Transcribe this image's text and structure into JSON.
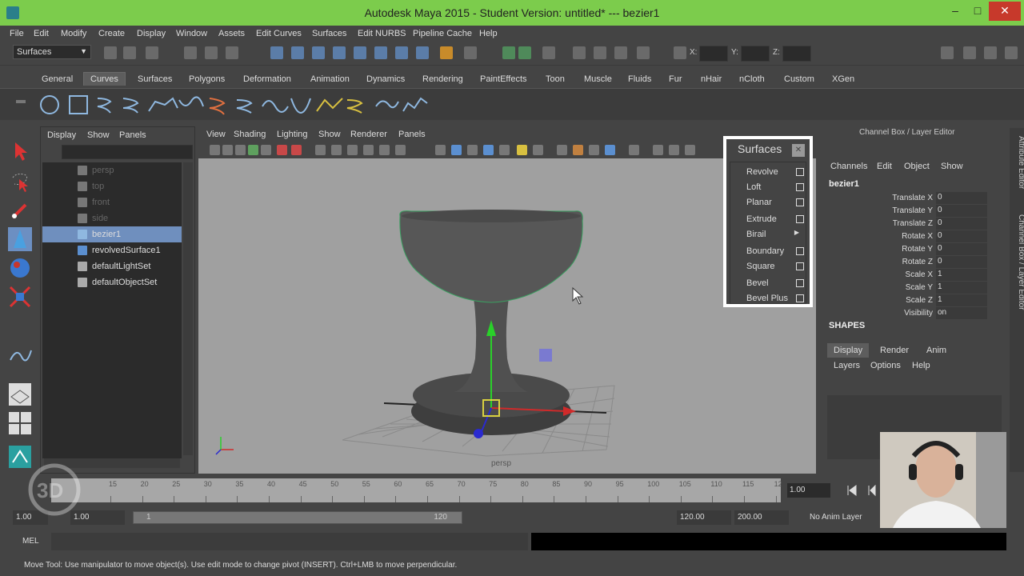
{
  "window": {
    "title": "Autodesk Maya 2015 - Student Version: untitled*   ---   bezier1"
  },
  "menubar": [
    "File",
    "Edit",
    "Modify",
    "Create",
    "Display",
    "Window",
    "Assets",
    "Edit Curves",
    "Surfaces",
    "Edit NURBS",
    "Pipeline Cache",
    "Help"
  ],
  "statusline": {
    "mode": "Surfaces",
    "x_label": "X:",
    "y_label": "Y:",
    "z_label": "Z:"
  },
  "shelf_tabs": [
    "General",
    "Curves",
    "Surfaces",
    "Polygons",
    "Deformation",
    "Animation",
    "Dynamics",
    "Rendering",
    "PaintEffects",
    "Toon",
    "Muscle",
    "Fluids",
    "Fur",
    "nHair",
    "nCloth",
    "Custom",
    "XGen"
  ],
  "shelf_active": "Curves",
  "outliner": {
    "menu": [
      "Display",
      "Show",
      "Panels"
    ],
    "items": [
      {
        "label": "persp",
        "dim": true
      },
      {
        "label": "top",
        "dim": true
      },
      {
        "label": "front",
        "dim": true
      },
      {
        "label": "side",
        "dim": true
      },
      {
        "label": "bezier1",
        "selected": true
      },
      {
        "label": "revolvedSurface1"
      },
      {
        "label": "defaultLightSet"
      },
      {
        "label": "defaultObjectSet"
      }
    ]
  },
  "viewport": {
    "menu": [
      "View",
      "Shading",
      "Lighting",
      "Show",
      "Renderer",
      "Panels"
    ],
    "camera": "persp"
  },
  "surfaces_popup": {
    "title": "Surfaces",
    "items": [
      {
        "label": "Revolve",
        "kind": "box"
      },
      {
        "label": "Loft",
        "kind": "box"
      },
      {
        "label": "Planar",
        "kind": "box"
      },
      {
        "label": "Extrude",
        "kind": "box"
      },
      {
        "label": "Birail",
        "kind": "arrow"
      },
      {
        "label": "Boundary",
        "kind": "box"
      },
      {
        "label": "Square",
        "kind": "box"
      },
      {
        "label": "Bevel",
        "kind": "box"
      },
      {
        "label": "Bevel Plus",
        "kind": "box"
      }
    ]
  },
  "channel_box": {
    "title": "Channel Box / Layer Editor",
    "menu": [
      "Channels",
      "Edit",
      "Object",
      "Show"
    ],
    "object": "bezier1",
    "attributes": [
      {
        "name": "Translate X",
        "value": "0"
      },
      {
        "name": "Translate Y",
        "value": "0"
      },
      {
        "name": "Translate Z",
        "value": "0"
      },
      {
        "name": "Rotate X",
        "value": "0"
      },
      {
        "name": "Rotate Y",
        "value": "0"
      },
      {
        "name": "Rotate Z",
        "value": "0"
      },
      {
        "name": "Scale X",
        "value": "1"
      },
      {
        "name": "Scale Y",
        "value": "1"
      },
      {
        "name": "Scale Z",
        "value": "1"
      },
      {
        "name": "Visibility",
        "value": "on"
      }
    ],
    "shapes_label": "SHAPES",
    "layer_tabs": [
      "Display",
      "Render",
      "Anim"
    ],
    "layer_menu": [
      "Layers",
      "Options",
      "Help"
    ]
  },
  "side_tabs": [
    "Attribute Editor",
    "Channel Box / Layer Editor"
  ],
  "timeline": {
    "ticks": [
      "15",
      "20",
      "25",
      "30",
      "35",
      "40",
      "45",
      "50",
      "55",
      "60",
      "65",
      "70",
      "75",
      "80",
      "85",
      "90",
      "95",
      "100",
      "105",
      "110",
      "115",
      "12"
    ],
    "current_time": "1.00"
  },
  "range": {
    "start": "1.00",
    "inner_start": "1.00",
    "bar_start": "1",
    "bar_end": "120",
    "end": "120.00",
    "anim_end": "200.00",
    "anim_layer": "No Anim Layer"
  },
  "cmdline": {
    "label": "MEL"
  },
  "helpline": {
    "text": "Move Tool: Use manipulator to move object(s). Use edit mode to change pivot (INSERT).  Ctrl+LMB to move perpendicular."
  },
  "colors": {
    "titlebar": "#7ccc4c",
    "selection": "#6f8fbe",
    "viewport_bg": "#a0a0a0"
  }
}
